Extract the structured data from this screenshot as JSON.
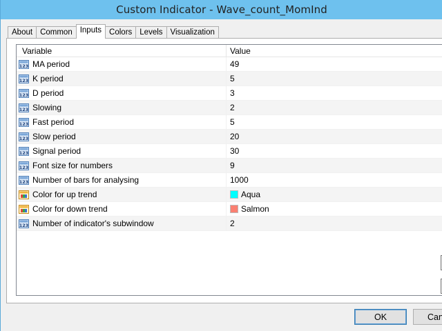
{
  "window": {
    "title": "Custom Indicator - Wave_count_MomInd"
  },
  "tabs": [
    {
      "label": "About",
      "active": false
    },
    {
      "label": "Common",
      "active": false
    },
    {
      "label": "Inputs",
      "active": true
    },
    {
      "label": "Colors",
      "active": false
    },
    {
      "label": "Levels",
      "active": false
    },
    {
      "label": "Visualization",
      "active": false
    }
  ],
  "grid": {
    "header": {
      "variable": "Variable",
      "value": "Value"
    },
    "rows": [
      {
        "variable": "MA period",
        "value": "49",
        "icon": "numeric-icon"
      },
      {
        "variable": "K period",
        "value": "5",
        "icon": "numeric-icon"
      },
      {
        "variable": "D period",
        "value": "3",
        "icon": "numeric-icon"
      },
      {
        "variable": "Slowing",
        "value": "2",
        "icon": "numeric-icon"
      },
      {
        "variable": "Fast period",
        "value": "5",
        "icon": "numeric-icon"
      },
      {
        "variable": "Slow period",
        "value": "20",
        "icon": "numeric-icon"
      },
      {
        "variable": "Signal period",
        "value": "30",
        "icon": "numeric-icon"
      },
      {
        "variable": "Font size for numbers",
        "value": "9",
        "icon": "numeric-icon"
      },
      {
        "variable": "Number of bars for analysing",
        "value": "1000",
        "icon": "numeric-icon"
      },
      {
        "variable": "Color for up trend",
        "value": "Aqua",
        "icon": "color-icon",
        "color": "#00ffff"
      },
      {
        "variable": "Color for down trend",
        "value": "Salmon",
        "icon": "color-icon",
        "color": "#fa8072"
      },
      {
        "variable": "Number of indicator's subwindow",
        "value": "2",
        "icon": "numeric-icon"
      }
    ]
  },
  "buttons": {
    "ok": "OK",
    "cancel": "Canc"
  },
  "colors": {
    "titlebar": "#6ec1ee",
    "accent": "#3c7fb1"
  }
}
